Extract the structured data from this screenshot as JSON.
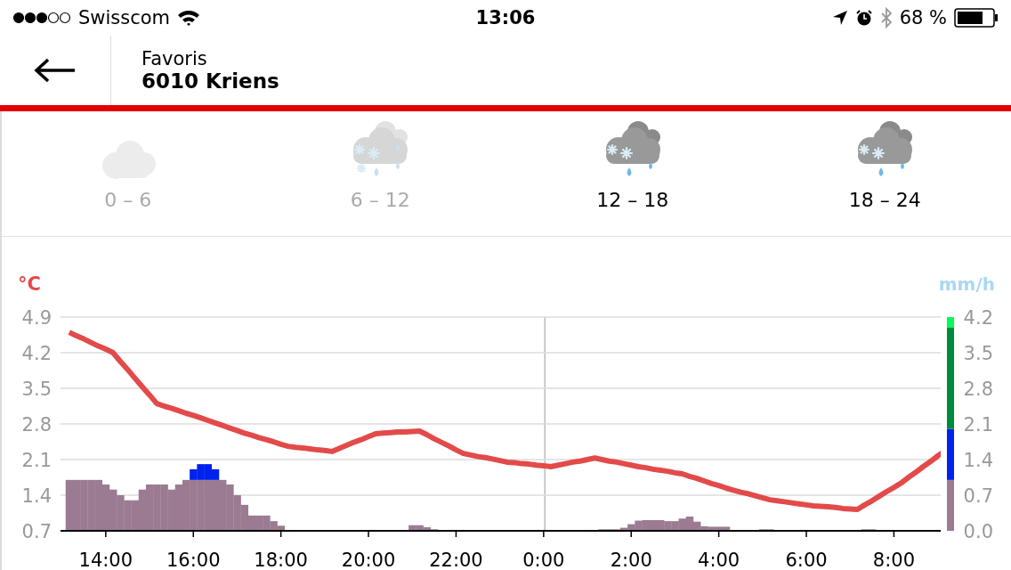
{
  "status_bar": {
    "carrier": "Swisscom",
    "time": "13:06",
    "battery": "68 %"
  },
  "header": {
    "subtitle": "Favoris",
    "title": "6010 Kriens"
  },
  "periods": [
    {
      "label": "0 – 6",
      "kind": "cloud",
      "past": true
    },
    {
      "label": "6 – 12",
      "kind": "snow_rain",
      "past": true
    },
    {
      "label": "12 – 18",
      "kind": "snow_rain",
      "past": false
    },
    {
      "label": "18 – 24",
      "kind": "snow_rain",
      "past": false
    }
  ],
  "forecast_chart": {
    "chart_data": {
      "type": "bar",
      "stacked": true,
      "grid": true,
      "ylabel": "°C",
      "ylim": [
        0.7,
        4.9
      ],
      "yticks": [
        4.9,
        4.2,
        3.5,
        2.8,
        2.1,
        1.4,
        0.7
      ],
      "y2label": "mm/h",
      "y2lim": [
        0,
        4.2
      ],
      "y2ticks": [
        {
          "value": 4.2,
          "label": "4.2"
        },
        {
          "value": 3.5,
          "label": "3.5"
        },
        {
          "value": 2.8,
          "label": "2.8"
        },
        {
          "value": 2.1,
          "label": "2.1"
        },
        {
          "value": 1.4,
          "label": "1.4"
        },
        {
          "value": 0.7,
          "label": "0.7"
        },
        {
          "value": 0,
          "label": "0.0"
        }
      ],
      "categories": [
        null,
        null,
        null,
        null,
        null,
        "14:00",
        null,
        null,
        null,
        null,
        null,
        null,
        null,
        null,
        null,
        null,
        null,
        "16:00",
        null,
        null,
        null,
        null,
        null,
        null,
        null,
        null,
        null,
        null,
        null,
        "18:00",
        null,
        null,
        null,
        null,
        null,
        null,
        null,
        null,
        null,
        null,
        null,
        "20:00",
        null,
        null,
        null,
        null,
        null,
        null,
        null,
        null,
        null,
        null,
        null,
        "22:00",
        null,
        null,
        null,
        null,
        null,
        null,
        null,
        null,
        null,
        null,
        null,
        "0:00",
        null,
        null,
        null,
        null,
        null,
        null,
        null,
        null,
        null,
        null,
        null,
        "2:00",
        null,
        null,
        null,
        null,
        null,
        null,
        null,
        null,
        null,
        null,
        null,
        "4:00",
        null,
        null,
        null,
        null,
        null,
        null,
        null,
        null,
        null,
        null,
        null,
        "6:00",
        null,
        null,
        null,
        null,
        null,
        null,
        null,
        null,
        null,
        null,
        null,
        "8:00",
        null,
        null,
        null,
        null,
        null,
        null,
        null
      ],
      "series": [
        {
          "type": "line",
          "axis": "y",
          "color": "#e34a4a",
          "values": [
            4.6,
            4.53,
            4.47,
            4.4,
            4.33,
            4.27,
            4.2,
            4.03,
            3.87,
            3.7,
            3.53,
            3.37,
            3.2,
            3.15,
            3.11,
            3.06,
            3.01,
            2.97,
            2.92,
            2.87,
            2.82,
            2.77,
            2.72,
            2.67,
            2.62,
            2.58,
            2.53,
            2.49,
            2.45,
            2.4,
            2.36,
            2.34,
            2.33,
            2.31,
            2.29,
            2.28,
            2.26,
            2.32,
            2.38,
            2.44,
            2.49,
            2.55,
            2.61,
            2.62,
            2.63,
            2.64,
            2.64,
            2.65,
            2.66,
            2.59,
            2.51,
            2.44,
            2.37,
            2.29,
            2.22,
            2.19,
            2.16,
            2.14,
            2.11,
            2.08,
            2.05,
            2.04,
            2.02,
            2.01,
            1.99,
            1.98,
            1.96,
            1.99,
            2.02,
            2.05,
            2.07,
            2.1,
            2.13,
            2.1,
            2.07,
            2.05,
            2.02,
            1.99,
            1.96,
            1.94,
            1.91,
            1.89,
            1.87,
            1.84,
            1.82,
            1.77,
            1.73,
            1.68,
            1.63,
            1.59,
            1.54,
            1.5,
            1.46,
            1.43,
            1.39,
            1.35,
            1.31,
            1.29,
            1.27,
            1.25,
            1.23,
            1.21,
            1.19,
            1.18,
            1.17,
            1.16,
            1.14,
            1.13,
            1.12,
            1.21,
            1.29,
            1.38,
            1.47,
            1.55,
            1.64,
            1.75,
            1.85,
            1.96,
            2.06,
            2.17,
            2.27
          ]
        },
        {
          "axis": "y2",
          "color": "#9b7b92",
          "values": [
            1,
            1,
            1,
            1,
            1,
            0.91,
            0.81,
            0.7,
            0.6,
            0.6,
            0.81,
            0.91,
            0.91,
            0.91,
            0.81,
            0.91,
            1,
            1,
            1,
            1,
            1,
            1,
            0.91,
            0.7,
            0.51,
            0.3,
            0.3,
            0.3,
            0.19,
            0.1,
            0,
            0,
            0,
            0,
            0,
            0,
            0,
            0,
            0,
            0,
            0,
            0,
            0,
            0,
            0,
            0,
            0,
            0.11,
            0.11,
            0.07,
            0.03,
            null,
            0,
            0,
            0,
            0,
            0,
            0,
            0,
            0,
            0,
            0,
            0,
            0,
            0,
            0,
            0,
            0,
            0,
            0,
            0,
            0,
            0,
            0.03,
            0.03,
            0.03,
            0.06,
            0.13,
            0.2,
            0.21,
            0.21,
            0.21,
            0.19,
            0.19,
            0.24,
            0.28,
            0.18,
            0.09,
            0.08,
            0.08,
            0.08,
            null,
            0,
            0,
            0,
            0.03,
            0.03,
            0,
            0,
            0,
            0,
            0,
            0,
            0,
            0,
            0,
            0,
            0,
            0,
            0.03,
            0.03,
            0,
            0,
            0,
            0,
            0,
            0,
            0,
            0,
            0,
            0
          ]
        },
        {
          "axis": "y2",
          "color": "#0022ee",
          "values": [
            0,
            0,
            0,
            0,
            0,
            0,
            0,
            0,
            0,
            0,
            0,
            0,
            0,
            0,
            0,
            0,
            0,
            0.21,
            0.31,
            0.31,
            0.21,
            0,
            0,
            0,
            0,
            0,
            0,
            0,
            0,
            0,
            0,
            0,
            0,
            0,
            0,
            0,
            0,
            0,
            0,
            0,
            0,
            0,
            0,
            0,
            0,
            0,
            0,
            0,
            0,
            0,
            0,
            0,
            0,
            0,
            0,
            0,
            0,
            0,
            0,
            0,
            0,
            0,
            0,
            0,
            0,
            0,
            0,
            0,
            0,
            0,
            0,
            0,
            0,
            0,
            0,
            0,
            0,
            0,
            0,
            0,
            0,
            0,
            0,
            0,
            0,
            0,
            0,
            0,
            0,
            0,
            0,
            0,
            0,
            0,
            0,
            0,
            0,
            0,
            0,
            0,
            0,
            0,
            0,
            0,
            0,
            0,
            0,
            0,
            0,
            0,
            0,
            0,
            0,
            0,
            0,
            0,
            0,
            0,
            0,
            0,
            0
          ]
        }
      ]
    },
    "intensity_scale": [
      {
        "color": "#9b7b92"
      },
      {
        "color": "#0022ee"
      },
      {
        "color": "#008a3c"
      },
      {
        "color": "#00ff55"
      }
    ]
  }
}
